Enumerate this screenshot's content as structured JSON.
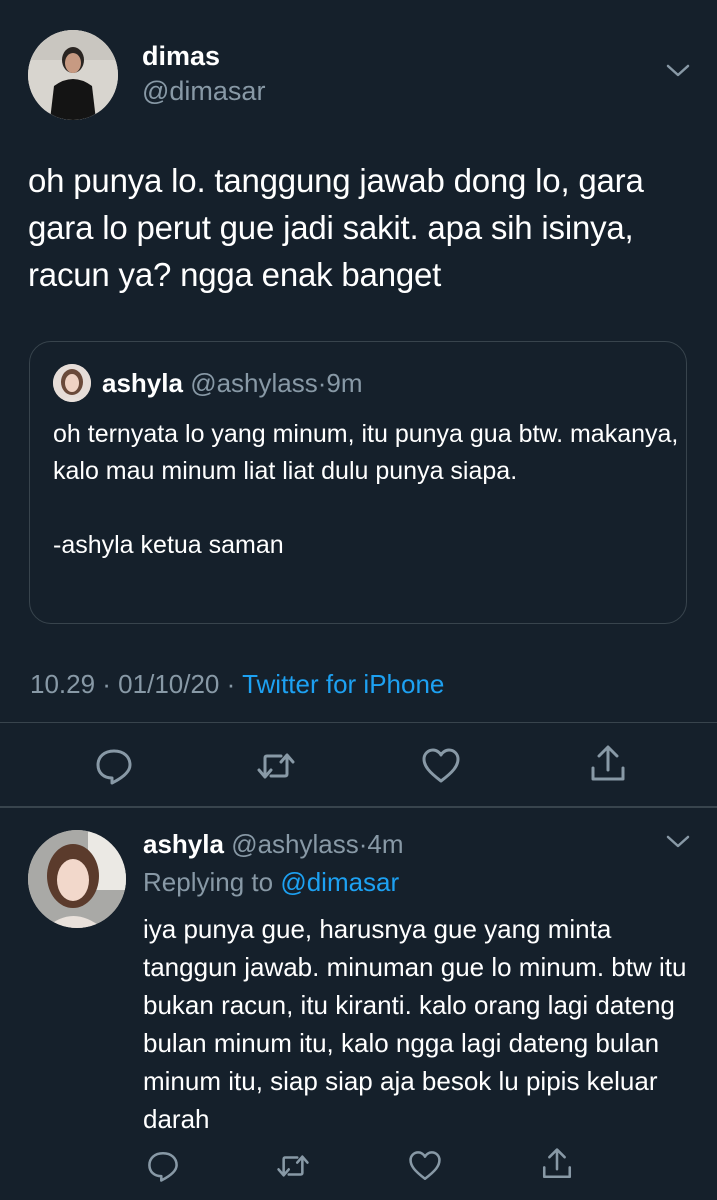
{
  "main_tweet": {
    "name": "dimas",
    "handle": "@dimasar",
    "text": "oh punya lo. tanggung jawab dong lo, gara gara lo perut gue jadi sakit. apa sih isinya, racun ya? ngga enak banget",
    "quoted": {
      "name": "ashyla",
      "handle": "@ashylass",
      "sep": "·",
      "time": "9m",
      "text": "oh ternyata lo yang minum, itu punya gua btw. makanya, kalo mau minum liat liat dulu punya siapa.\n\n-ashyla ketua saman"
    },
    "timestamp": "10.29 · 01/10/20",
    "sep": "·",
    "source": "Twitter for iPhone"
  },
  "reply": {
    "name": "ashyla",
    "handle": "@ashylass",
    "sep": "·",
    "time": "4m",
    "replying_label": "Replying to",
    "replying_to": "@dimasar",
    "text": "iya punya gue, harusnya gue yang minta tanggun jawab. minuman gue lo minum. btw itu bukan racun, itu kiranti. kalo orang lagi dateng bulan minum itu, kalo ngga lagi dateng bulan minum itu, siap siap aja besok lu pipis keluar darah"
  },
  "icons": {
    "reply": "comment-icon",
    "retweet": "retweet-icon",
    "like": "heart-icon",
    "share": "share-icon",
    "menu": "chevron-down-icon"
  },
  "colors": {
    "background": "#15202b",
    "muted": "#8899a6",
    "accent": "#1da1f2",
    "border": "#38444d"
  }
}
